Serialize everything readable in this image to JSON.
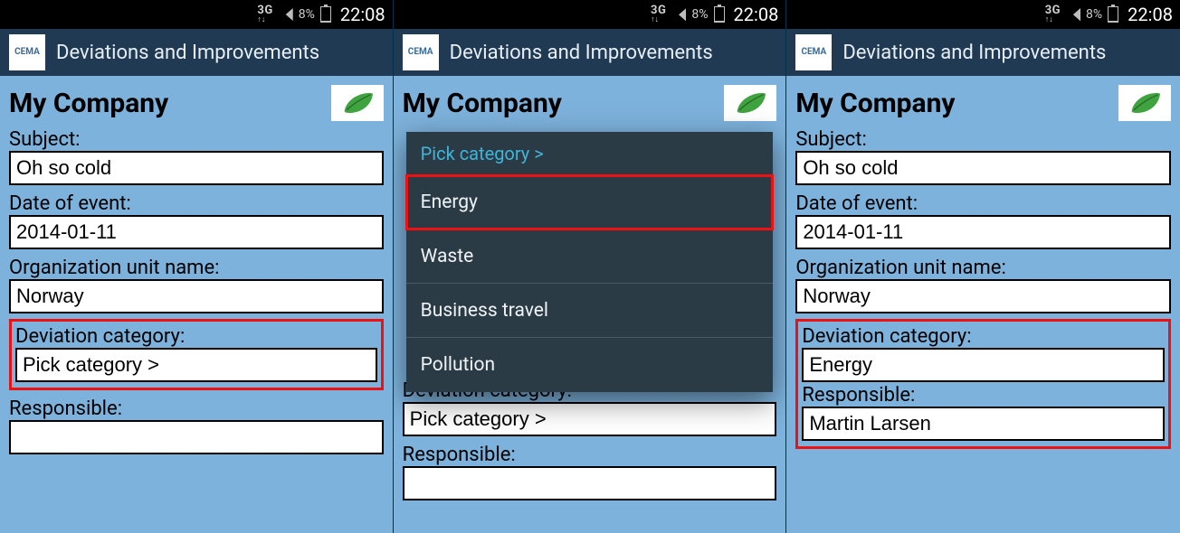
{
  "statusbar": {
    "network_label": "3G",
    "battery_pct": "8%",
    "clock": "22:08"
  },
  "actionbar": {
    "logo_text": "CEMA",
    "title": "Deviations and Improvements"
  },
  "company": {
    "name": "My Company"
  },
  "labels": {
    "subject": "Subject:",
    "date_of_event": "Date of event:",
    "org_unit": "Organization unit name:",
    "deviation_category": "Deviation category:",
    "responsible": "Responsible:"
  },
  "screens": [
    {
      "subject": "Oh so cold",
      "date_of_event": "2014-01-11",
      "org_unit": "Norway",
      "deviation_category": "Pick category >",
      "responsible": "",
      "highlight": "deviation_category",
      "dropdown_open": false
    },
    {
      "subject": "",
      "date_of_event": "",
      "org_unit": "",
      "deviation_category": "Pick category >",
      "responsible": "",
      "highlight": null,
      "dropdown_open": true
    },
    {
      "subject": "Oh so cold",
      "date_of_event": "2014-01-11",
      "org_unit": "Norway",
      "deviation_category": "Energy",
      "responsible": "Martin Larsen",
      "highlight": "deviation_and_responsible",
      "dropdown_open": false
    }
  ],
  "dropdown": {
    "header": "Pick category >",
    "options": [
      "Energy",
      "Waste",
      "Business travel",
      "Pollution"
    ],
    "highlighted": "Energy"
  }
}
